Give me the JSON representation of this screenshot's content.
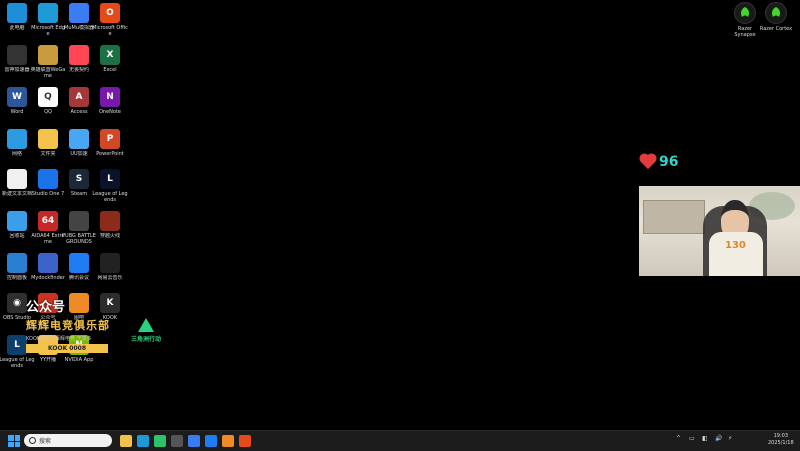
{
  "desktop_icons": [
    {
      "label": "此电脑",
      "color": "#1c8fd8",
      "icon": "computer-icon"
    },
    {
      "label": "Microsoft Edge",
      "color": "#1e9ad6",
      "icon": "edge-icon"
    },
    {
      "label": "MuMu模拟器",
      "color": "#3b7cf5",
      "icon": "mumu-icon"
    },
    {
      "label": "Microsoft Office",
      "color": "#e64a19",
      "icon": "office-icon"
    },
    {
      "label": "雷神加速器",
      "color": "#333333",
      "icon": "accelerator-icon"
    },
    {
      "label": "英雄联盟WeGame",
      "color": "#c89b3c",
      "icon": "lol-icon"
    },
    {
      "label": "无畏契约",
      "color": "#ff4655",
      "icon": "valorant-icon"
    },
    {
      "label": "Excel",
      "color": "#1d7044",
      "icon": "excel-icon"
    },
    {
      "label": "Word",
      "color": "#2b579a",
      "icon": "word-icon"
    },
    {
      "label": "QQ",
      "color": "#ffffff",
      "icon": "qq-icon"
    },
    {
      "label": "Access",
      "color": "#a4373a",
      "icon": "access-icon"
    },
    {
      "label": "OneNote",
      "color": "#7719aa",
      "icon": "onenote-icon"
    },
    {
      "label": "网络",
      "color": "#2d9be0",
      "icon": "network-icon"
    },
    {
      "label": "文件夹",
      "color": "#f3c24b",
      "icon": "folder-icon"
    },
    {
      "label": "UU加速",
      "color": "#49a6f2",
      "icon": "uu-icon"
    },
    {
      "label": "PowerPoint",
      "color": "#d24726",
      "icon": "powerpoint-icon"
    },
    {
      "label": "新建文本文档",
      "color": "#f0f0f0",
      "icon": "text-file-icon"
    },
    {
      "label": "Studio One 7",
      "color": "#1a73e8",
      "icon": "studio-one-icon"
    },
    {
      "label": "Steam",
      "color": "#1b2838",
      "icon": "steam-icon"
    },
    {
      "label": "League of Legends",
      "color": "#0a1428",
      "icon": "league-icon"
    },
    {
      "label": "回收站",
      "color": "#3b9ee8",
      "icon": "recycle-bin-icon"
    },
    {
      "label": "AIDA64 Extreme",
      "color": "#c62828",
      "icon": "aida64-icon"
    },
    {
      "label": "PUBG BATTLEGROUNDS",
      "color": "#444444",
      "icon": "pubg-icon"
    },
    {
      "label": "穿越火线",
      "color": "#8b2c1b",
      "icon": "game-icon"
    },
    {
      "label": "控制面板",
      "color": "#2a7fd1",
      "icon": "control-panel-icon"
    },
    {
      "label": "Mydockfinder",
      "color": "#3c63c9",
      "icon": "dock-icon"
    },
    {
      "label": "腾讯会议",
      "color": "#1f7cf2",
      "icon": "meeting-icon"
    },
    {
      "label": "网易云音乐",
      "color": "#222222",
      "icon": "music-icon"
    },
    {
      "label": "OBS Studio",
      "color": "#302e31",
      "icon": "obs-icon"
    },
    {
      "label": "公众号",
      "color": "#cc3322",
      "icon": "wechat-official-icon"
    },
    {
      "label": "图吧",
      "color": "#f08a24",
      "icon": "folder-icon"
    },
    {
      "label": "KOOK",
      "color": "#2c2c2c",
      "icon": "kook-icon"
    },
    {
      "label": "League of Legends",
      "color": "#0d3f6b",
      "icon": "league-icon"
    },
    {
      "label": "YY开播",
      "color": "#f8c146",
      "icon": "yy-icon"
    },
    {
      "label": "NVIDIA App",
      "color": "#76b900",
      "icon": "nvidia-icon"
    }
  ],
  "right_icons": [
    {
      "label": "Razer Synapse",
      "icon": "razer-icon"
    },
    {
      "label": "Razer Cortex",
      "icon": "razer-icon"
    }
  ],
  "overlay": {
    "top_text": "公众号",
    "brand_name": "辉辉电竞俱乐部",
    "brand_sub": "KOOK频道 | 辉辉电竞 干货多",
    "kook_id": "KOOK 0008",
    "team_name": "三角洲行动"
  },
  "heart_count": "96",
  "webcam": {
    "shirt_text": "130"
  },
  "taskbar": {
    "search_placeholder": "搜索",
    "apps": [
      {
        "name": "taskbar-app-files",
        "color": "#f3c24b"
      },
      {
        "name": "taskbar-app-edge",
        "color": "#1e9ad6"
      },
      {
        "name": "taskbar-app-wechat",
        "color": "#2dc26b"
      },
      {
        "name": "taskbar-app-obs",
        "color": "#555555"
      },
      {
        "name": "taskbar-app-qq",
        "color": "#3b7cf5"
      },
      {
        "name": "taskbar-app-mumu",
        "color": "#1f7cf2"
      },
      {
        "name": "taskbar-app-yy",
        "color": "#f08a24"
      },
      {
        "name": "taskbar-app-streamer",
        "color": "#e64a19"
      }
    ],
    "tray": [
      "^",
      "▭",
      "◧",
      "🔊",
      "⚡"
    ],
    "time": "19:03",
    "date": "2025/1/18"
  }
}
